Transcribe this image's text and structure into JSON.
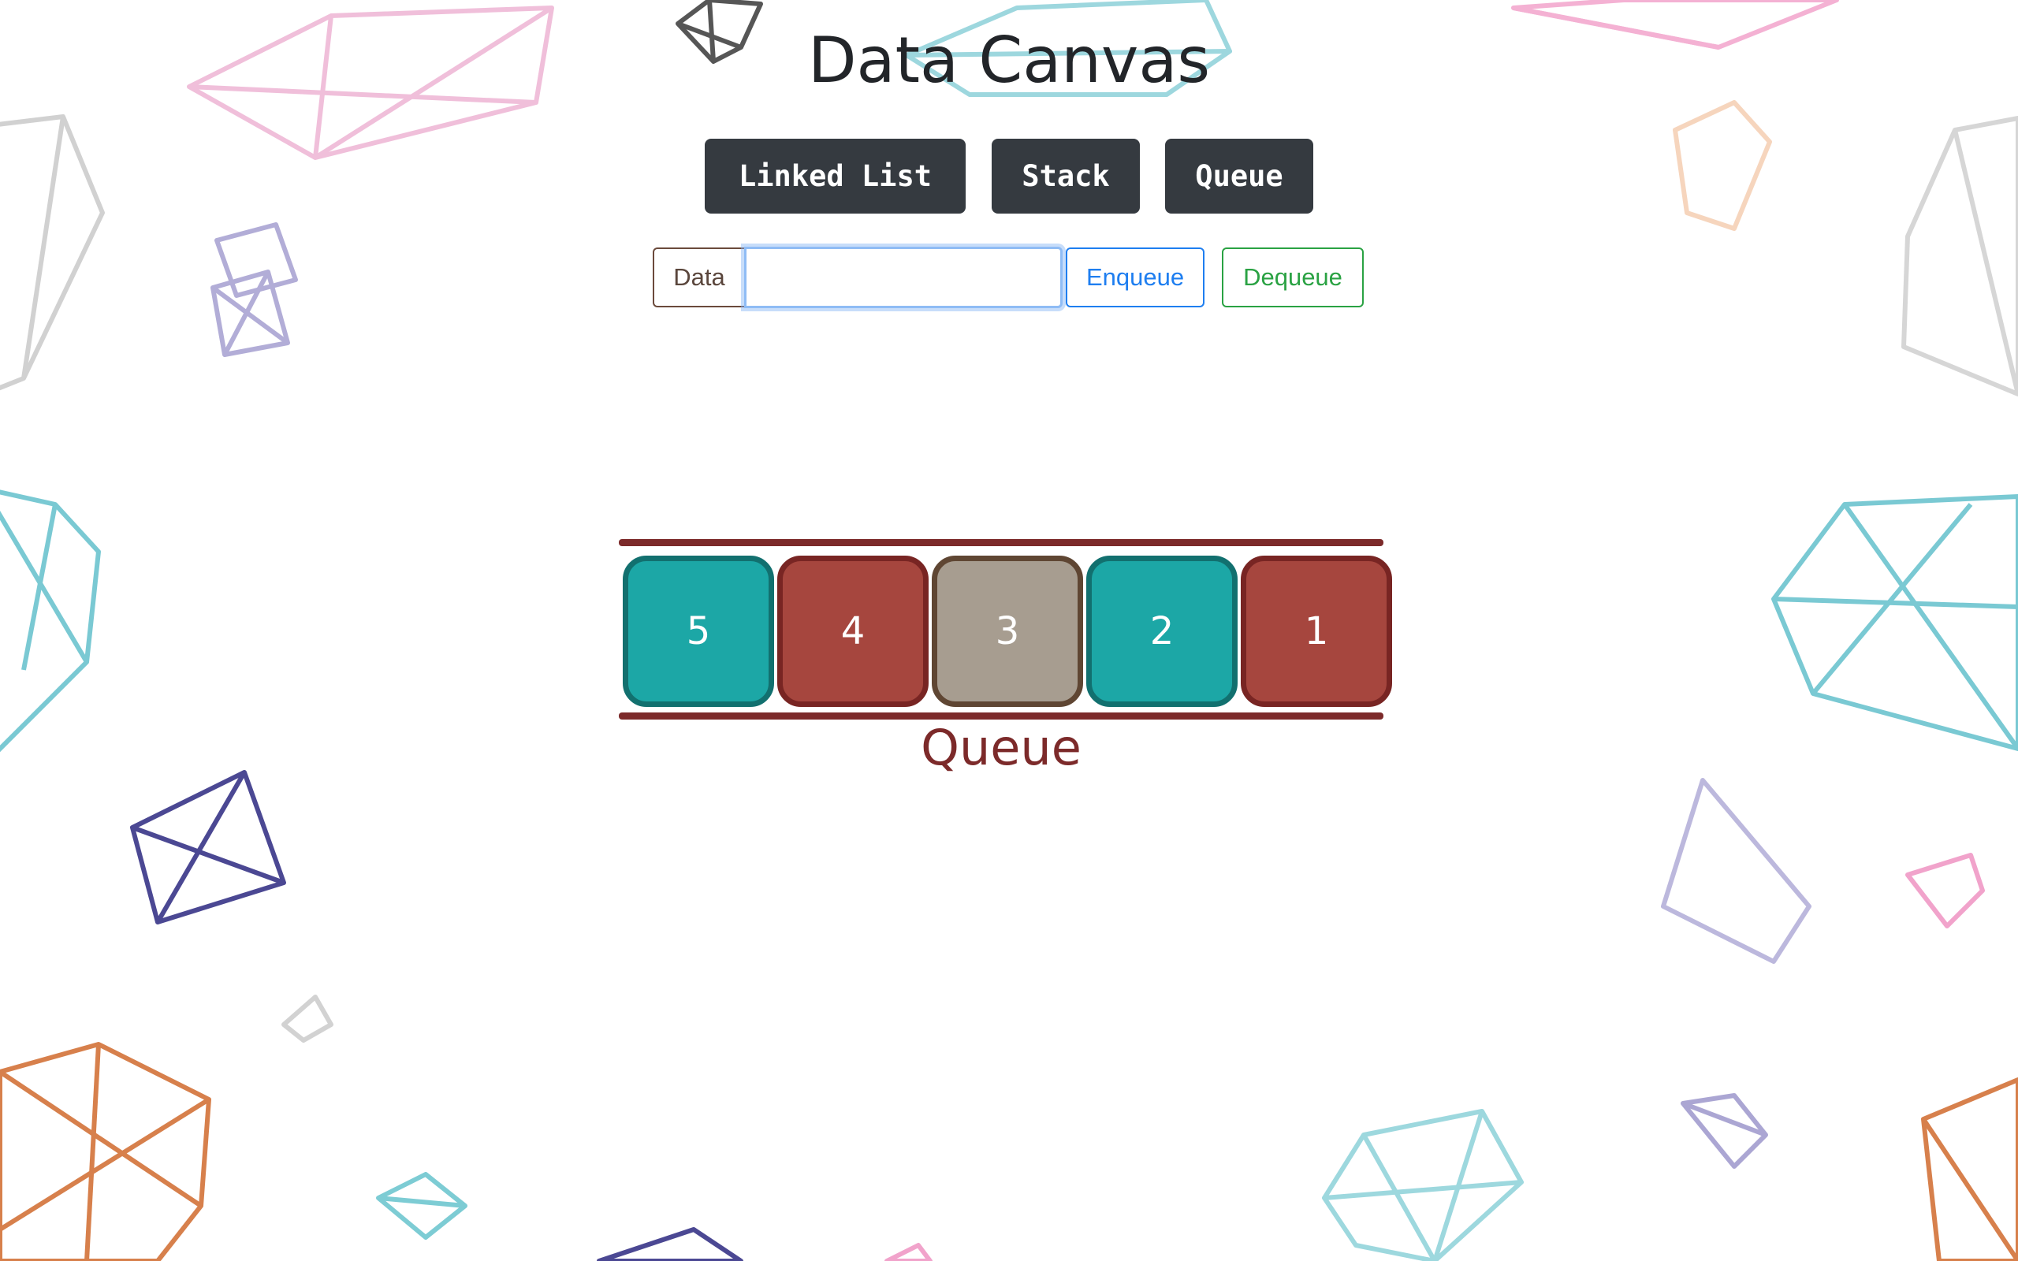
{
  "app": {
    "title": "Data Canvas"
  },
  "structure_buttons": [
    {
      "label": "Linked List"
    },
    {
      "label": "Stack"
    },
    {
      "label": "Queue"
    }
  ],
  "data_input": {
    "label": "Data",
    "value": "",
    "placeholder": ""
  },
  "actions": {
    "enqueue": "Enqueue",
    "dequeue": "Dequeue"
  },
  "queue": {
    "label": "Queue",
    "items": [
      {
        "value": "5",
        "color": "teal"
      },
      {
        "value": "4",
        "color": "red"
      },
      {
        "value": "3",
        "color": "gray"
      },
      {
        "value": "2",
        "color": "teal"
      },
      {
        "value": "1",
        "color": "red"
      }
    ]
  },
  "colors": {
    "dark_button": "#353a40",
    "enqueue": "#1e7ef0",
    "dequeue": "#2aa243",
    "rail": "#7c2a2a",
    "teal_node": "#1ca7a6",
    "red_node": "#a6463e",
    "gray_node": "#a79d90"
  }
}
